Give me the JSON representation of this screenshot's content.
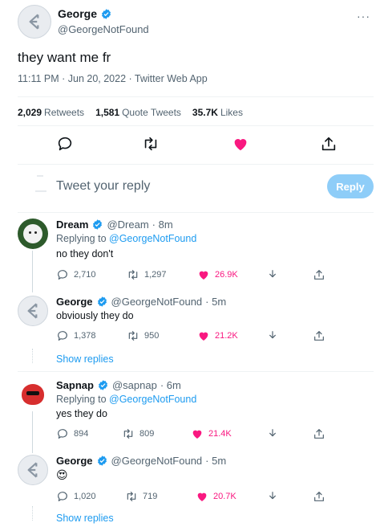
{
  "main_tweet": {
    "author_name": "George",
    "author_handle": "@GeorgeNotFound",
    "text": "they want me fr",
    "meta": "11:11 PM · Jun 20, 2022 · Twitter Web App",
    "stats": [
      {
        "value": "2,029",
        "label": "Retweets"
      },
      {
        "value": "1,581",
        "label": "Quote Tweets"
      },
      {
        "value": "35.7K",
        "label": "Likes"
      }
    ],
    "liked": true
  },
  "reply_box": {
    "placeholder": "Tweet your reply",
    "button_label": "Reply"
  },
  "replies": [
    {
      "name": "Dream",
      "handle": "@Dream",
      "time": "· 8m",
      "replying_to_prefix": "Replying to ",
      "replying_to": "@GeorgeNotFound",
      "text": "no they don't",
      "replies": "2,710",
      "retweets": "1,297",
      "likes": "26.9K"
    },
    {
      "name": "George",
      "handle": "@GeorgeNotFound",
      "time": "· 5m",
      "text": "obviously they do",
      "replies": "1,378",
      "retweets": "950",
      "likes": "21.2K",
      "show_replies": "Show replies"
    },
    {
      "name": "Sapnap",
      "handle": "@sapnap",
      "time": "· 6m",
      "replying_to_prefix": "Replying to ",
      "replying_to": "@GeorgeNotFound",
      "text": "yes they do",
      "replies": "894",
      "retweets": "809",
      "likes": "21.4K"
    },
    {
      "name": "George",
      "handle": "@GeorgeNotFound",
      "time": "· 5m",
      "text": "😍",
      "replies": "1,020",
      "retweets": "719",
      "likes": "20.7K",
      "show_replies": "Show replies"
    }
  ],
  "colors": {
    "accent": "#1d9bf0",
    "like": "#f91880",
    "text": "#0f1419",
    "muted": "#536471"
  }
}
